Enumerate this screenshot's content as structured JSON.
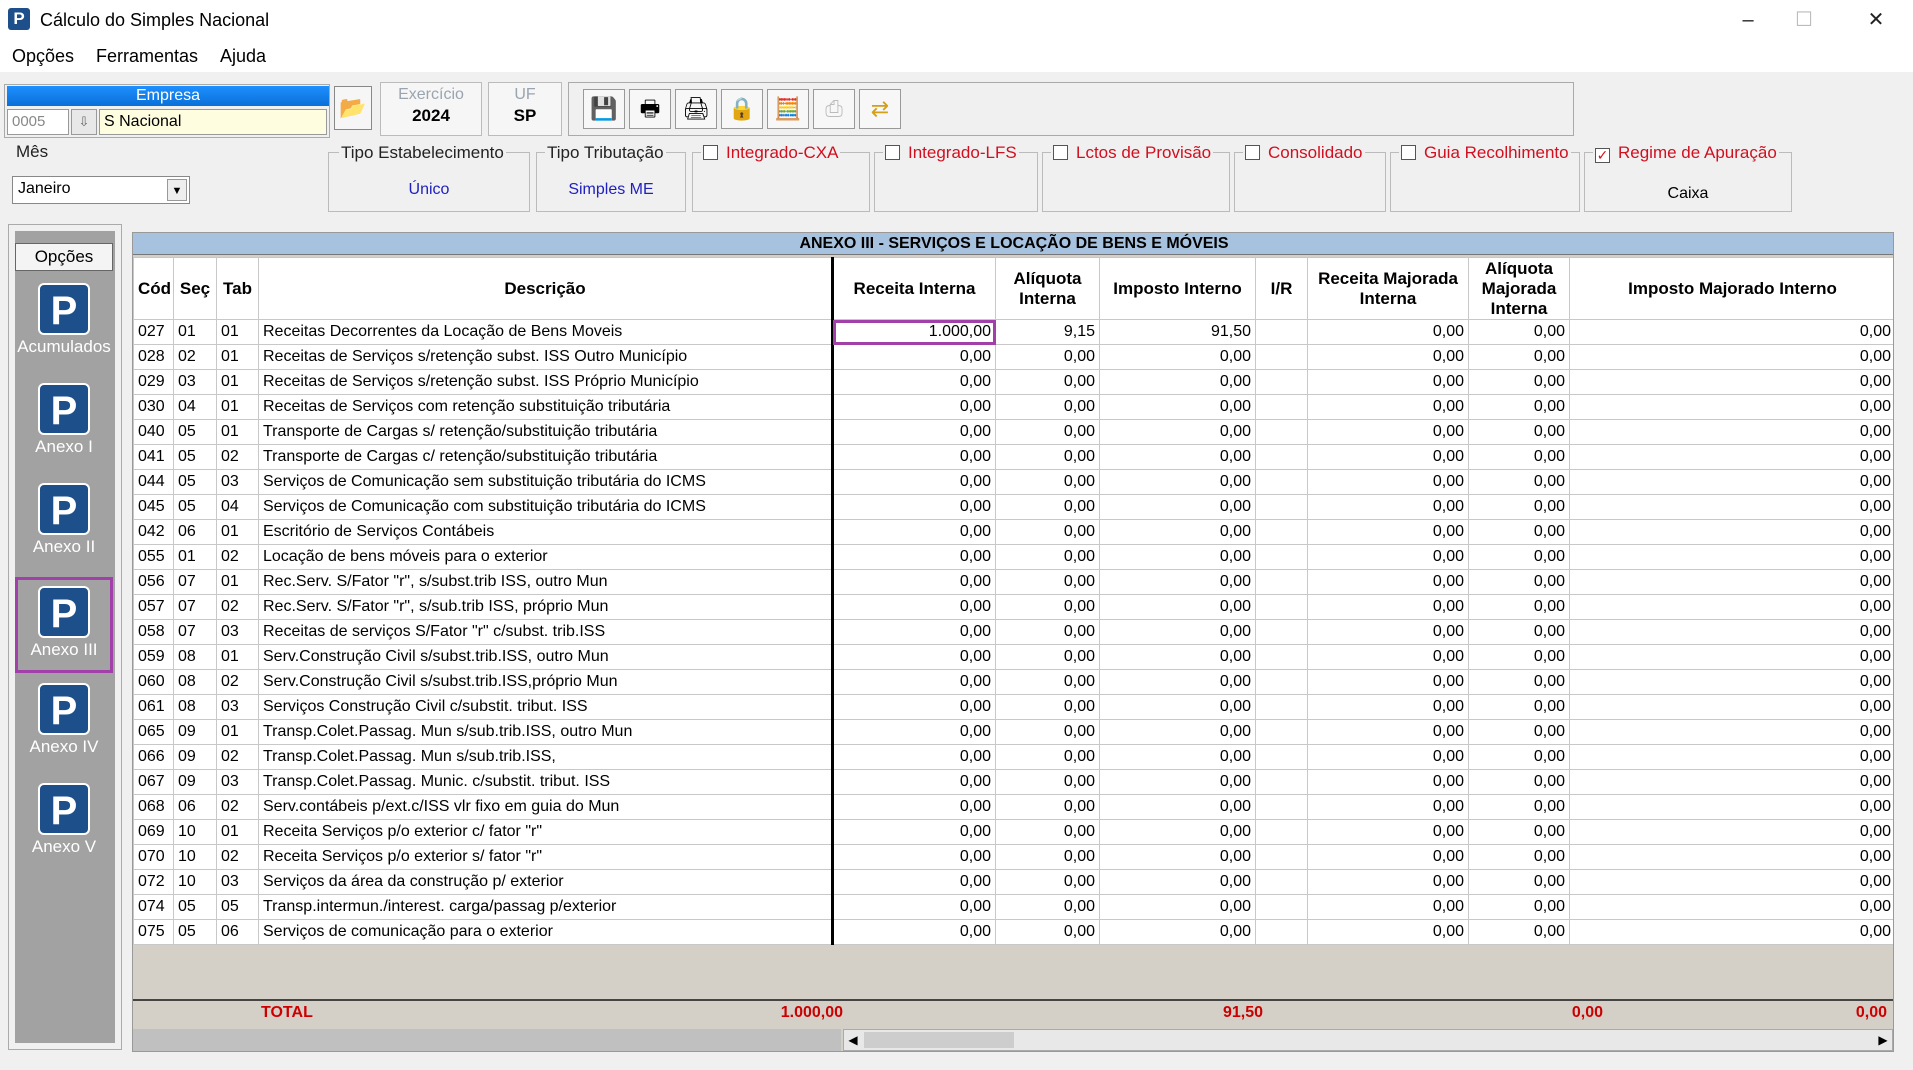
{
  "window": {
    "title": "Cálculo do Simples Nacional",
    "minimize": "–",
    "maximize": "☐",
    "close": "✕",
    "icon": "P"
  },
  "menu": {
    "opcoes": "Opções",
    "ferramentas": "Ferramentas",
    "ajuda": "Ajuda"
  },
  "empresa": {
    "header": "Empresa",
    "code": "0005",
    "name": "S Nacional"
  },
  "exercicio": {
    "label": "Exercício",
    "value": "2024"
  },
  "uf": {
    "label": "UF",
    "value": "SP"
  },
  "toolbar": {
    "icons": [
      "save-icon",
      "print-icon",
      "printer-settings-icon",
      "lock-icon",
      "calculator-icon",
      "disabled-print-icon",
      "transfer-icon"
    ]
  },
  "filters": {
    "mes": {
      "label": "Mês",
      "value": "Janeiro"
    },
    "tipo_estabelecimento": {
      "label": "Tipo Estabelecimento",
      "value": "Único"
    },
    "tipo_tributacao": {
      "label": "Tipo Tributação",
      "value": "Simples ME"
    },
    "integrado_cxa": {
      "label": "Integrado-CXA",
      "checked": false
    },
    "integrado_lfs": {
      "label": "Integrado-LFS",
      "checked": false
    },
    "lctos_provisao": {
      "label": "Lctos de Provisão",
      "checked": false
    },
    "consolidado": {
      "label": "Consolidado",
      "checked": false
    },
    "guia_recolhimento": {
      "label": "Guia Recolhimento",
      "checked": false
    },
    "regime_apuracao": {
      "label": "Regime de Apuração",
      "checked": true,
      "value": "Caixa"
    }
  },
  "sidebar": {
    "opcoes": "Opções",
    "items": [
      {
        "label": "Acumulados",
        "active": false
      },
      {
        "label": "Anexo I",
        "active": false
      },
      {
        "label": "Anexo II",
        "active": false
      },
      {
        "label": "Anexo III",
        "active": true
      },
      {
        "label": "Anexo IV",
        "active": false
      },
      {
        "label": "Anexo V",
        "active": false
      }
    ]
  },
  "grid": {
    "title": "ANEXO III - SERVIÇOS E LOCAÇÃO DE BENS E MÓVEIS",
    "headers": {
      "cod": "Cód",
      "sec": "Seç",
      "tab": "Tab",
      "descricao": "Descrição",
      "receita": "Receita Interna",
      "aliquota": "Alíquota Interna",
      "imposto": "Imposto Interno",
      "ir": "I/R",
      "receita_maj": "Receita Majorada Interna",
      "aliquota_maj": "Alíquota Majorada Interna",
      "imposto_maj": "Imposto Majorado Interno"
    },
    "rows": [
      [
        "027",
        "01",
        "01",
        "Receitas Decorrentes da Locação de Bens Moveis",
        "1.000,00",
        "9,15",
        "91,50",
        "",
        "0,00",
        "0,00",
        "0,00"
      ],
      [
        "028",
        "02",
        "01",
        "Receitas de Serviços s/retenção subst. ISS Outro Município",
        "0,00",
        "0,00",
        "0,00",
        "",
        "0,00",
        "0,00",
        "0,00"
      ],
      [
        "029",
        "03",
        "01",
        "Receitas de Serviços s/retenção subst. ISS Próprio Município",
        "0,00",
        "0,00",
        "0,00",
        "",
        "0,00",
        "0,00",
        "0,00"
      ],
      [
        "030",
        "04",
        "01",
        "Receitas de Serviços com retenção substituição tributária",
        "0,00",
        "0,00",
        "0,00",
        "",
        "0,00",
        "0,00",
        "0,00"
      ],
      [
        "040",
        "05",
        "01",
        "Transporte de Cargas s/ retenção/substituição tributária",
        "0,00",
        "0,00",
        "0,00",
        "",
        "0,00",
        "0,00",
        "0,00"
      ],
      [
        "041",
        "05",
        "02",
        "Transporte de Cargas c/ retenção/substituição tributária",
        "0,00",
        "0,00",
        "0,00",
        "",
        "0,00",
        "0,00",
        "0,00"
      ],
      [
        "044",
        "05",
        "03",
        "Serviços de Comunicação sem substituição tributária do ICMS",
        "0,00",
        "0,00",
        "0,00",
        "",
        "0,00",
        "0,00",
        "0,00"
      ],
      [
        "045",
        "05",
        "04",
        "Serviços de Comunicação com substituição tributária do ICMS",
        "0,00",
        "0,00",
        "0,00",
        "",
        "0,00",
        "0,00",
        "0,00"
      ],
      [
        "042",
        "06",
        "01",
        "Escritório de Serviços Contábeis",
        "0,00",
        "0,00",
        "0,00",
        "",
        "0,00",
        "0,00",
        "0,00"
      ],
      [
        "055",
        "01",
        "02",
        "Locação de bens móveis para o exterior",
        "0,00",
        "0,00",
        "0,00",
        "",
        "0,00",
        "0,00",
        "0,00"
      ],
      [
        "056",
        "07",
        "01",
        "Rec.Serv. S/Fator \"r\", s/subst.trib ISS, outro Mun",
        "0,00",
        "0,00",
        "0,00",
        "",
        "0,00",
        "0,00",
        "0,00"
      ],
      [
        "057",
        "07",
        "02",
        "Rec.Serv. S/Fator \"r\", s/sub.trib ISS, próprio Mun",
        "0,00",
        "0,00",
        "0,00",
        "",
        "0,00",
        "0,00",
        "0,00"
      ],
      [
        "058",
        "07",
        "03",
        "Receitas de serviços S/Fator \"r\" c/subst. trib.ISS",
        "0,00",
        "0,00",
        "0,00",
        "",
        "0,00",
        "0,00",
        "0,00"
      ],
      [
        "059",
        "08",
        "01",
        "Serv.Construção Civil  s/subst.trib.ISS, outro Mun",
        "0,00",
        "0,00",
        "0,00",
        "",
        "0,00",
        "0,00",
        "0,00"
      ],
      [
        "060",
        "08",
        "02",
        "Serv.Construção Civil s/subst.trib.ISS,próprio Mun",
        "0,00",
        "0,00",
        "0,00",
        "",
        "0,00",
        "0,00",
        "0,00"
      ],
      [
        "061",
        "08",
        "03",
        "Serviços Construção Civil c/substit. tribut. ISS",
        "0,00",
        "0,00",
        "0,00",
        "",
        "0,00",
        "0,00",
        "0,00"
      ],
      [
        "065",
        "09",
        "01",
        "Transp.Colet.Passag. Mun s/sub.trib.ISS, outro Mun",
        "0,00",
        "0,00",
        "0,00",
        "",
        "0,00",
        "0,00",
        "0,00"
      ],
      [
        "066",
        "09",
        "02",
        "Transp.Colet.Passag. Mun s/sub.trib.ISS,",
        "0,00",
        "0,00",
        "0,00",
        "",
        "0,00",
        "0,00",
        "0,00"
      ],
      [
        "067",
        "09",
        "03",
        "Transp.Colet.Passag. Munic. c/substit. tribut. ISS",
        "0,00",
        "0,00",
        "0,00",
        "",
        "0,00",
        "0,00",
        "0,00"
      ],
      [
        "068",
        "06",
        "02",
        "Serv.contábeis p/ext.c/ISS vlr fixo em guia do Mun",
        "0,00",
        "0,00",
        "0,00",
        "",
        "0,00",
        "0,00",
        "0,00"
      ],
      [
        "069",
        "10",
        "01",
        "Receita Serviços p/o exterior c/ fator \"r\"",
        "0,00",
        "0,00",
        "0,00",
        "",
        "0,00",
        "0,00",
        "0,00"
      ],
      [
        "070",
        "10",
        "02",
        "Receita Serviços p/o exterior s/ fator \"r\"",
        "0,00",
        "0,00",
        "0,00",
        "",
        "0,00",
        "0,00",
        "0,00"
      ],
      [
        "072",
        "10",
        "03",
        "Serviços da área da construção p/ exterior",
        "0,00",
        "0,00",
        "0,00",
        "",
        "0,00",
        "0,00",
        "0,00"
      ],
      [
        "074",
        "05",
        "05",
        "Transp.intermun./interest. carga/passag p/exterior",
        "0,00",
        "0,00",
        "0,00",
        "",
        "0,00",
        "0,00",
        "0,00"
      ],
      [
        "075",
        "05",
        "06",
        "Serviços de comunicação para o exterior",
        "0,00",
        "0,00",
        "0,00",
        "",
        "0,00",
        "0,00",
        "0,00"
      ]
    ],
    "total": {
      "label": "TOTAL",
      "receita": "1.000,00",
      "imposto": "91,50",
      "receita_maj": "0,00",
      "imposto_maj": "0,00"
    }
  }
}
